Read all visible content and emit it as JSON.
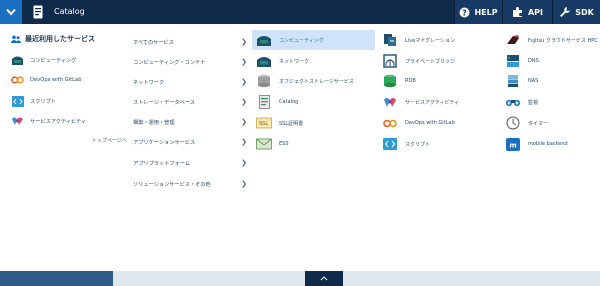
{
  "header": {
    "title": "Catalog",
    "help_label": "HELP",
    "api_label": "API",
    "sdk_label": "SDK"
  },
  "favorites": {
    "heading": "最近利用したサービス",
    "items": [
      {
        "label": "コンピューティング",
        "icon": "computing-icon"
      },
      {
        "label": "DevOps with GitLab",
        "icon": "devops-icon"
      },
      {
        "label": "スクリプト",
        "icon": "script-icon"
      },
      {
        "label": "サービスアクティビティ",
        "icon": "service-activity-icon"
      }
    ],
    "top_page_link": "トップページへ"
  },
  "categories": [
    {
      "label": "すべてのサービス"
    },
    {
      "label": "コンピューティング・コンテナ"
    },
    {
      "label": "ネットワーク"
    },
    {
      "label": "ストレージ・データベース"
    },
    {
      "label": "構築・運用・管理"
    },
    {
      "label": "アプリケーションサービス"
    },
    {
      "label": "アプリプラットフォーム"
    },
    {
      "label": "ソリューションサービス・その他"
    }
  ],
  "services": {
    "col1": [
      {
        "label": "コンピューティング",
        "icon": "computing-icon",
        "active": true
      },
      {
        "label": "ネットワーク",
        "icon": "network-icon"
      },
      {
        "label": "オブジェクトストレージサービス",
        "icon": "object-storage-icon"
      },
      {
        "label": "Catalog",
        "icon": "catalog-icon"
      },
      {
        "label": "SSL証明書",
        "icon": "ssl-certificate-icon"
      },
      {
        "label": "ESS",
        "icon": "ess-icon"
      }
    ],
    "col2": [
      {
        "label": "Liveマイグレーション",
        "icon": "live-migration-icon"
      },
      {
        "label": "プライベートブリッジ",
        "icon": "private-bridge-icon"
      },
      {
        "label": "RDB",
        "icon": "rdb-icon"
      },
      {
        "label": "サービスアクティビティ",
        "icon": "service-activity-icon"
      },
      {
        "label": "DevOps with GitLab",
        "icon": "devops-icon"
      },
      {
        "label": "スクリプト",
        "icon": "script-icon"
      }
    ],
    "col3": [
      {
        "label": "Fujitsu クラウドサービス HPC",
        "icon": "hpc-icon"
      },
      {
        "label": "DNS",
        "icon": "dns-icon"
      },
      {
        "label": "NAS",
        "icon": "nas-icon"
      },
      {
        "label": "監視",
        "icon": "monitoring-icon"
      },
      {
        "label": "タイマー",
        "icon": "timer-icon"
      },
      {
        "label": "mobile backend",
        "icon": "mobile-backend-icon"
      }
    ]
  },
  "colors": {
    "header_bg": "#0f2a4a",
    "toggle_bg": "#1a6fc0",
    "active_bg": "#cfe4f8",
    "text": "#2a4a6a"
  }
}
